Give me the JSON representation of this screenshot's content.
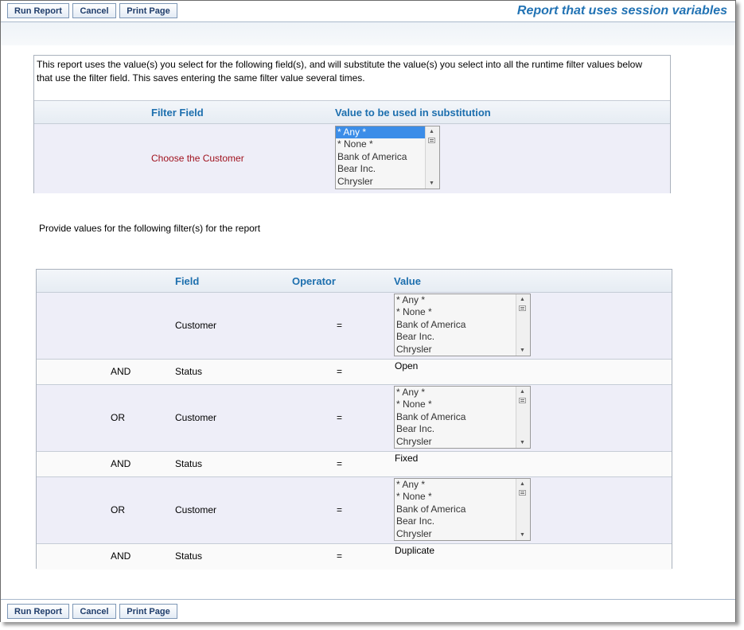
{
  "toolbar": {
    "run_label": "Run Report",
    "cancel_label": "Cancel",
    "print_label": "Print Page"
  },
  "page_title": "Report that uses session variables",
  "substitution": {
    "intro": "This report uses the value(s) you select for the following field(s), and will substitute the value(s) you select into all the runtime filter values below that use the filter field. This saves entering the same filter value several times.",
    "col_filter_field": "Filter Field",
    "col_value": "Value to be used in substitution",
    "filter_label": "Choose the Customer",
    "options": [
      "* Any *",
      "* None *",
      "Bank of America",
      "Bear Inc.",
      "Chrysler"
    ],
    "selected": "* Any *"
  },
  "filters": {
    "section_label": "Provide values for the following filter(s) for the report",
    "col_field": "Field",
    "col_operator": "Operator",
    "col_value": "Value",
    "rows": [
      {
        "conj": "",
        "field": "Customer",
        "op": "=",
        "type": "list"
      },
      {
        "conj": "AND",
        "field": "Status",
        "op": "=",
        "type": "text",
        "value": "Open"
      },
      {
        "conj": "OR",
        "field": "Customer",
        "op": "=",
        "type": "list"
      },
      {
        "conj": "AND",
        "field": "Status",
        "op": "=",
        "type": "text",
        "value": "Fixed"
      },
      {
        "conj": "OR",
        "field": "Customer",
        "op": "=",
        "type": "list"
      },
      {
        "conj": "AND",
        "field": "Status",
        "op": "=",
        "type": "text",
        "value": "Duplicate"
      }
    ],
    "options": [
      "* Any *",
      "* None *",
      "Bank of America",
      "Bear Inc.",
      "Chrysler"
    ]
  },
  "icons": {
    "scroll_up": "scroll-up-icon",
    "scroll_down": "scroll-down-icon",
    "scroll_grip": "scroll-grip-icon"
  }
}
